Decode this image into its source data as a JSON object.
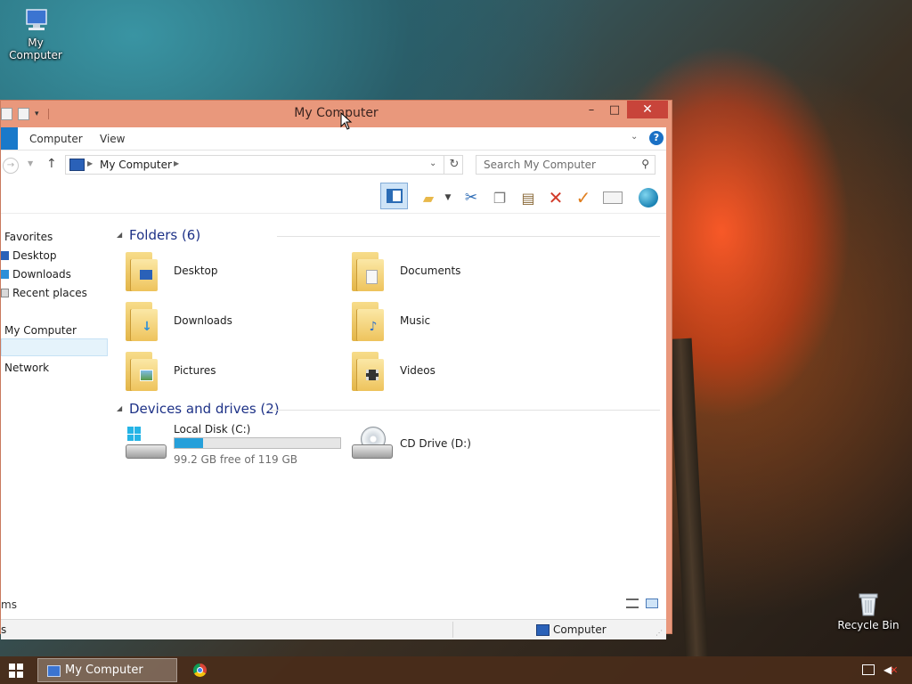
{
  "desktop": {
    "icons": [
      {
        "label": "My Computer",
        "icon": "computer-icon"
      },
      {
        "label": "Recycle Bin",
        "icon": "recycle-bin-icon"
      }
    ]
  },
  "window": {
    "title": "My Computer",
    "controls": {
      "minimize": "–",
      "maximize": "□",
      "close": "✕"
    },
    "ribbon": {
      "tabs": [
        "Computer",
        "View"
      ],
      "help": "?"
    },
    "address": {
      "location": "My Computer",
      "search_placeholder": "Search My Computer"
    },
    "nav_pane": {
      "favorites_header": "Favorites",
      "favorites": [
        "Desktop",
        "Downloads",
        "Recent places"
      ],
      "computer": "My Computer",
      "network": "Network"
    },
    "content": {
      "folders_header": "Folders (6)",
      "folders": [
        {
          "label": "Desktop",
          "icon": "desktop-folder-icon"
        },
        {
          "label": "Documents",
          "icon": "documents-folder-icon"
        },
        {
          "label": "Downloads",
          "icon": "downloads-folder-icon"
        },
        {
          "label": "Music",
          "icon": "music-folder-icon"
        },
        {
          "label": "Pictures",
          "icon": "pictures-folder-icon"
        },
        {
          "label": "Videos",
          "icon": "videos-folder-icon"
        }
      ],
      "devices_header": "Devices and drives (2)",
      "drives": [
        {
          "label": "Local Disk (C:)",
          "free_text": "99.2 GB free of 119 GB",
          "used_fraction": 0.17
        },
        {
          "label": "CD Drive (D:)"
        }
      ]
    },
    "status": {
      "items_text": "ms",
      "bar_left": "s",
      "location": "Computer"
    }
  },
  "taskbar": {
    "active_task": "My Computer"
  },
  "colors": {
    "window_frame": "#e9987c",
    "close_button": "#c8443a",
    "accent": "#1979ca",
    "group_header": "#1e3287",
    "disk_fill": "#26a0da"
  }
}
